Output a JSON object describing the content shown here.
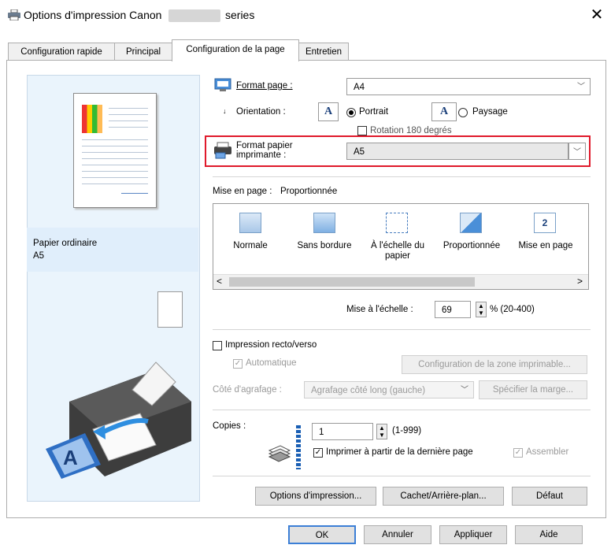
{
  "window": {
    "title_prefix": "Options d'impression Canon",
    "title_suffix": "series",
    "close_glyph": "✕"
  },
  "tabs": [
    {
      "label": "Configuration rapide"
    },
    {
      "label": "Principal"
    },
    {
      "label": "Configuration de la page"
    },
    {
      "label": "Entretien"
    }
  ],
  "preview": {
    "paper_type": "Papier ordinaire",
    "paper_size": "A5"
  },
  "page_size": {
    "label": "Format page :",
    "value": "A4"
  },
  "orientation": {
    "label": "Orientation :",
    "portrait": "Portrait",
    "landscape": "Paysage",
    "portrait_selected": true,
    "rotate_label": "Rotation 180 degrés"
  },
  "printer_paper": {
    "label_line1": "Format papier",
    "label_line2": "imprimante :",
    "value": "A5"
  },
  "page_layout": {
    "label": "Mise en page :",
    "current": "Proportionnée",
    "options": [
      "Normale",
      "Sans bordure",
      "À l'échelle du papier",
      "Proportionnée",
      "Mise en page"
    ],
    "scroll_left": "<",
    "scroll_right": ">"
  },
  "scaling": {
    "label": "Mise à l'échelle :",
    "value": "69",
    "range": "% (20-400)"
  },
  "duplex": {
    "label": "Impression recto/verso",
    "auto_label": "Automatique",
    "print_area_button": "Configuration de la zone imprimable...",
    "stapling_label": "Côté d'agrafage :",
    "stapling_value": "Agrafage côté long (gauche)",
    "margin_button": "Spécifier la marge..."
  },
  "copies": {
    "label": "Copies :",
    "value": "1",
    "range": "(1-999)",
    "last_page_first_label": "Imprimer à partir de la dernière page",
    "collate_label": "Assembler"
  },
  "bottom_buttons": {
    "options": "Options d'impression...",
    "stamp": "Cachet/Arrière-plan...",
    "defaults": "Défaut"
  },
  "dialog_buttons": {
    "ok": "OK",
    "cancel": "Annuler",
    "apply": "Appliquer",
    "help": "Aide"
  },
  "colors": {
    "highlight_border": "#e0192b",
    "preview_bg": "#eaf4fc"
  },
  "icons": [
    "printer-icon",
    "close-icon",
    "page-size-icon",
    "portrait-icon",
    "landscape-icon",
    "printer-paper-icon",
    "layout-normal-icon",
    "layout-borderless-icon",
    "layout-fit-icon",
    "layout-scaled-icon",
    "layout-page-layout-icon",
    "copies-stack-icon"
  ]
}
